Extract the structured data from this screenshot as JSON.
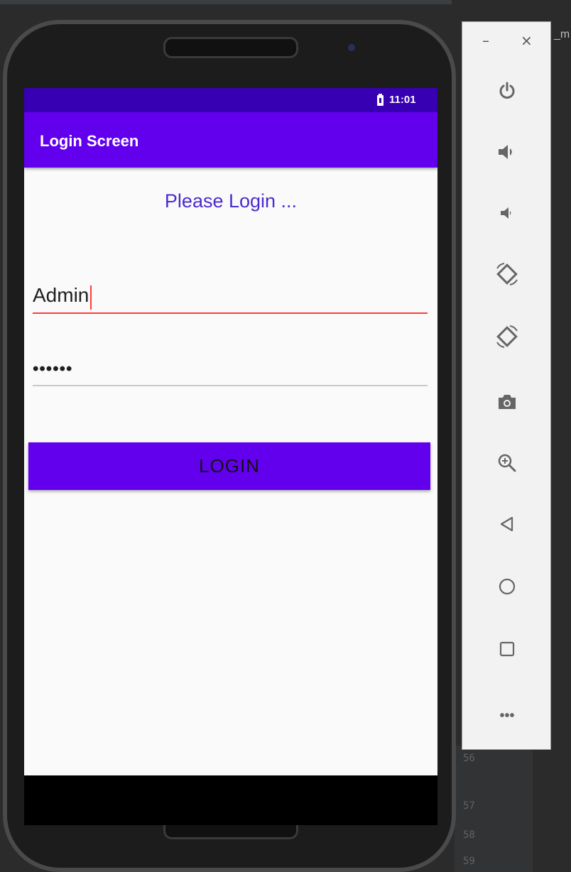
{
  "status_bar": {
    "time": "11:01"
  },
  "app_bar": {
    "title": "Login Screen"
  },
  "main": {
    "heading": "Please Login ...",
    "username_value": "Admin",
    "password_value": "••••••",
    "login_label": "LOGIN"
  },
  "emulator_toolbar": {
    "minimize": "–",
    "close": "×",
    "more": "•••",
    "items": [
      "power-icon",
      "volume-up-icon",
      "volume-down-icon",
      "rotate-left-icon",
      "rotate-right-icon",
      "camera-icon",
      "zoom-icon",
      "back-icon",
      "home-icon",
      "overview-icon"
    ]
  },
  "ide": {
    "line_numbers": [
      "56",
      "57",
      "58",
      "59"
    ],
    "partial_tab_text": "_m"
  },
  "colors": {
    "status_bar": "#3700b3",
    "app_bar": "#6200ee",
    "heading": "#4b2bd0",
    "focus_underline": "#ff3b3b"
  }
}
